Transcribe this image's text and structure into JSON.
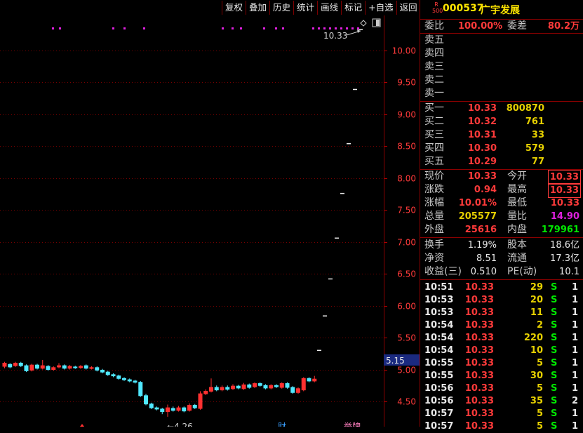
{
  "toolbar": {
    "buttons": [
      "复权",
      "叠加",
      "历史",
      "统计",
      "画线",
      "标记",
      "+自选",
      "返回"
    ]
  },
  "chart": {
    "price_axis": [
      "10.00",
      "9.50",
      "9.00",
      "8.50",
      "8.00",
      "7.50",
      "7.00",
      "6.50",
      "6.00",
      "5.50",
      "5.00",
      "4.50"
    ],
    "current_price_tag": "5.15",
    "high_label": "10.33",
    "low_label": "4.26",
    "bottom_markers": [
      "财",
      "举牌"
    ]
  },
  "chart_data": {
    "type": "candlestick",
    "ylim": [
      4.25,
      10.75
    ],
    "max_marker": 10.33,
    "min_marker": 4.26,
    "candles": [
      {
        "o": 5.05,
        "c": 5.1,
        "h": 5.12,
        "l": 5.02
      },
      {
        "o": 5.08,
        "c": 5.04,
        "h": 5.1,
        "l": 5.02
      },
      {
        "o": 5.06,
        "c": 5.1,
        "h": 5.12,
        "l": 5.04
      },
      {
        "o": 5.1,
        "c": 5.06,
        "h": 5.12,
        "l": 5.04
      },
      {
        "o": 5.06,
        "c": 4.98,
        "h": 5.08,
        "l": 4.96
      },
      {
        "o": 4.99,
        "c": 5.07,
        "h": 5.09,
        "l": 4.97
      },
      {
        "o": 5.07,
        "c": 5.02,
        "h": 5.09,
        "l": 5.0
      },
      {
        "o": 5.02,
        "c": 5.06,
        "h": 5.15,
        "l": 5.0
      },
      {
        "o": 5.05,
        "c": 5.0,
        "h": 5.07,
        "l": 4.98
      },
      {
        "o": 5.0,
        "c": 5.03,
        "h": 5.05,
        "l": 4.98
      },
      {
        "o": 5.04,
        "c": 5.06,
        "h": 5.1,
        "l": 5.02
      },
      {
        "o": 5.06,
        "c": 5.02,
        "h": 5.08,
        "l": 5.0
      },
      {
        "o": 5.02,
        "c": 5.05,
        "h": 5.07,
        "l": 5.0
      },
      {
        "o": 5.04,
        "c": 5.03,
        "h": 5.06,
        "l": 5.01
      },
      {
        "o": 5.03,
        "c": 5.05,
        "h": 5.07,
        "l": 5.01
      },
      {
        "o": 5.06,
        "c": 5.02,
        "h": 5.08,
        "l": 5.0
      },
      {
        "o": 5.02,
        "c": 5.03,
        "h": 5.05,
        "l": 5.0
      },
      {
        "o": 5.03,
        "c": 4.99,
        "h": 5.05,
        "l": 4.97
      },
      {
        "o": 4.99,
        "c": 4.96,
        "h": 5.01,
        "l": 4.94
      },
      {
        "o": 4.96,
        "c": 4.92,
        "h": 4.98,
        "l": 4.9
      },
      {
        "o": 4.92,
        "c": 4.9,
        "h": 4.94,
        "l": 4.88
      },
      {
        "o": 4.9,
        "c": 4.86,
        "h": 4.92,
        "l": 4.84
      },
      {
        "o": 4.86,
        "c": 4.84,
        "h": 4.88,
        "l": 4.82
      },
      {
        "o": 4.84,
        "c": 4.82,
        "h": 4.86,
        "l": 4.8
      },
      {
        "o": 4.82,
        "c": 4.8,
        "h": 4.84,
        "l": 4.78
      },
      {
        "o": 4.8,
        "c": 4.59,
        "h": 4.82,
        "l": 4.57
      },
      {
        "o": 4.59,
        "c": 4.46,
        "h": 4.62,
        "l": 4.44
      },
      {
        "o": 4.46,
        "c": 4.4,
        "h": 4.48,
        "l": 4.38
      },
      {
        "o": 4.4,
        "c": 4.38,
        "h": 4.42,
        "l": 4.36
      },
      {
        "o": 4.38,
        "c": 4.34,
        "h": 4.4,
        "l": 4.3
      },
      {
        "o": 4.34,
        "c": 4.4,
        "h": 4.45,
        "l": 4.26
      },
      {
        "o": 4.39,
        "c": 4.36,
        "h": 4.42,
        "l": 4.34
      },
      {
        "o": 4.36,
        "c": 4.4,
        "h": 4.43,
        "l": 4.34
      },
      {
        "o": 4.4,
        "c": 4.35,
        "h": 4.42,
        "l": 4.33
      },
      {
        "o": 4.36,
        "c": 4.44,
        "h": 4.47,
        "l": 4.34
      },
      {
        "o": 4.44,
        "c": 4.4,
        "h": 4.46,
        "l": 4.38
      },
      {
        "o": 4.39,
        "c": 4.62,
        "h": 4.66,
        "l": 4.37
      },
      {
        "o": 4.62,
        "c": 4.66,
        "h": 4.69,
        "l": 4.6
      },
      {
        "o": 4.66,
        "c": 4.72,
        "h": 4.86,
        "l": 4.64
      },
      {
        "o": 4.72,
        "c": 4.68,
        "h": 4.75,
        "l": 4.66
      },
      {
        "o": 4.68,
        "c": 4.72,
        "h": 4.75,
        "l": 4.66
      },
      {
        "o": 4.72,
        "c": 4.69,
        "h": 4.75,
        "l": 4.67
      },
      {
        "o": 4.7,
        "c": 4.74,
        "h": 4.77,
        "l": 4.68
      },
      {
        "o": 4.74,
        "c": 4.71,
        "h": 4.76,
        "l": 4.69
      },
      {
        "o": 4.7,
        "c": 4.76,
        "h": 4.79,
        "l": 4.68
      },
      {
        "o": 4.76,
        "c": 4.72,
        "h": 4.78,
        "l": 4.7
      },
      {
        "o": 4.73,
        "c": 4.78,
        "h": 4.8,
        "l": 4.71
      },
      {
        "o": 4.78,
        "c": 4.75,
        "h": 4.8,
        "l": 4.73
      },
      {
        "o": 4.75,
        "c": 4.71,
        "h": 4.77,
        "l": 4.69
      },
      {
        "o": 4.71,
        "c": 4.75,
        "h": 4.77,
        "l": 4.69
      },
      {
        "o": 4.75,
        "c": 4.73,
        "h": 4.77,
        "l": 4.71
      },
      {
        "o": 4.72,
        "c": 4.78,
        "h": 4.8,
        "l": 4.7
      },
      {
        "o": 4.78,
        "c": 4.72,
        "h": 4.8,
        "l": 4.7
      },
      {
        "o": 4.72,
        "c": 4.64,
        "h": 4.74,
        "l": 4.62
      },
      {
        "o": 4.64,
        "c": 4.7,
        "h": 4.72,
        "l": 4.62
      },
      {
        "o": 4.68,
        "c": 4.86,
        "h": 4.88,
        "l": 4.66
      },
      {
        "o": 4.86,
        "c": 4.82,
        "h": 4.88,
        "l": 4.8
      },
      {
        "o": 4.82,
        "c": 4.85,
        "h": 4.9,
        "l": 4.8
      }
    ],
    "limit_up_dashes": [
      5.3,
      5.84,
      6.42,
      7.06,
      7.76,
      8.54,
      9.39,
      10.33
    ],
    "dot_rows_y": 10.56
  },
  "quote": {
    "market_badge": "R",
    "board": "500",
    "code": "000537",
    "name": "广宇发展",
    "weibi_label": "委比",
    "weibi": "100.00%",
    "weicha_label": "委差",
    "weicha": "80.2万",
    "sells": [
      {
        "label": "卖五"
      },
      {
        "label": "卖四"
      },
      {
        "label": "卖三"
      },
      {
        "label": "卖二"
      },
      {
        "label": "卖一"
      }
    ],
    "buys": [
      {
        "label": "买一",
        "price": "10.33",
        "vol": "800870"
      },
      {
        "label": "买二",
        "price": "10.32",
        "vol": "761"
      },
      {
        "label": "买三",
        "price": "10.31",
        "vol": "33"
      },
      {
        "label": "买四",
        "price": "10.30",
        "vol": "579"
      },
      {
        "label": "买五",
        "price": "10.29",
        "vol": "77"
      }
    ],
    "stats1": [
      {
        "l1": "现价",
        "v1": "10.33",
        "l2": "今开",
        "v2": "10.33"
      },
      {
        "l1": "涨跌",
        "v1": "0.94",
        "l2": "最高",
        "v2": "10.33"
      },
      {
        "l1": "涨幅",
        "v1": "10.01%",
        "l2": "最低",
        "v2": "10.33"
      },
      {
        "l1": "总量",
        "v1": "205577",
        "l2": "量比",
        "v2": "14.90"
      },
      {
        "l1": "外盘",
        "v1": "25616",
        "l2": "内盘",
        "v2": "179961"
      }
    ],
    "stats2": [
      {
        "l1": "换手",
        "v1": "1.19%",
        "l2": "股本",
        "v2": "18.6亿"
      },
      {
        "l1": "净资",
        "v1": "8.51",
        "l2": "流通",
        "v2": "17.3亿"
      },
      {
        "l1": "收益(三)",
        "v1": "0.510",
        "l2": "PE(动)",
        "v2": "10.1"
      }
    ],
    "ticks": [
      {
        "t": "10:51",
        "p": "10.33",
        "v": "29",
        "s": "S",
        "n": "1"
      },
      {
        "t": "10:53",
        "p": "10.33",
        "v": "20",
        "s": "S",
        "n": "1"
      },
      {
        "t": "10:53",
        "p": "10.33",
        "v": "11",
        "s": "S",
        "n": "1"
      },
      {
        "t": "10:54",
        "p": "10.33",
        "v": "2",
        "s": "S",
        "n": "1"
      },
      {
        "t": "10:54",
        "p": "10.33",
        "v": "220",
        "s": "S",
        "n": "1"
      },
      {
        "t": "10:54",
        "p": "10.33",
        "v": "10",
        "s": "S",
        "n": "1"
      },
      {
        "t": "10:55",
        "p": "10.33",
        "v": "5",
        "s": "S",
        "n": "1"
      },
      {
        "t": "10:55",
        "p": "10.33",
        "v": "30",
        "s": "S",
        "n": "1"
      },
      {
        "t": "10:56",
        "p": "10.33",
        "v": "5",
        "s": "S",
        "n": "1"
      },
      {
        "t": "10:56",
        "p": "10.33",
        "v": "35",
        "s": "S",
        "n": "2"
      },
      {
        "t": "10:57",
        "p": "10.33",
        "v": "5",
        "s": "S",
        "n": "1"
      },
      {
        "t": "10:57",
        "p": "10.33",
        "v": "5",
        "s": "S",
        "n": "1"
      }
    ]
  }
}
